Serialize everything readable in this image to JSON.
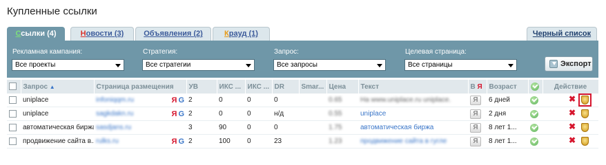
{
  "page": {
    "title": "Купленные ссылки"
  },
  "tabs": [
    {
      "accent": "С",
      "rest": "сылки (4)"
    },
    {
      "accent": "Н",
      "rest": "овости (3)"
    },
    {
      "accent": "О",
      "rest": "бъявления (2)"
    },
    {
      "accent": "К",
      "rest": "рауд (1)"
    }
  ],
  "blacklist": {
    "label": "Черный список"
  },
  "filters": {
    "campaign": {
      "label": "Рекламная кампания:",
      "value": "Все проекты"
    },
    "strategy": {
      "label": "Стратегия:",
      "value": "Все стратегии"
    },
    "query": {
      "label": "Запрос:",
      "value": "Все запросы"
    },
    "target": {
      "label": "Целевая страница:",
      "value": "Все страницы"
    },
    "export_label": "Экспорт"
  },
  "columns": {
    "query": "Запрос",
    "page": "Страница размещения",
    "uv": "УВ",
    "iks1": "ИКС ...",
    "iks2": "ИКС ...",
    "dr": "DR",
    "smart": "Smar...",
    "price": "Цена",
    "text": "Текст",
    "vya": "В",
    "age": "Возраст",
    "action": "Действие"
  },
  "rows": [
    {
      "query": "uniplace",
      "page": "infoniqqm.ru",
      "yandex": "Я",
      "google": "G",
      "uv": "2",
      "iks1": "0",
      "iks2": "0",
      "dr": "0",
      "smart": "",
      "price": "0.65",
      "text": "На www.uniplace.ru uniplace.",
      "age": "6 дней",
      "highlight": true
    },
    {
      "query": "uniplace",
      "page": "sagkdakn.ru",
      "yandex": "Я",
      "google": "G",
      "uv": "2",
      "iks1": "0",
      "iks2": "0",
      "dr": "н/д",
      "smart": "",
      "price": "0.55",
      "text": "uniplace",
      "age": "2 дня",
      "highlight": false
    },
    {
      "query": "автоматическая биржа",
      "page": "sasdjans.ru",
      "yandex": "",
      "google": "",
      "uv": "3",
      "iks1": "90",
      "iks2": "0",
      "dr": "0",
      "smart": "",
      "price": "1.75",
      "text": "автоматическая биржа",
      "age": "8 лет 1...",
      "highlight": false
    },
    {
      "query": "продвижение сайта в...",
      "page": "rulks.ru",
      "yandex": "Я",
      "google": "G",
      "uv": "2",
      "iks1": "100",
      "iks2": "0",
      "dr": "23",
      "smart": "",
      "price": "1.23",
      "text": "продвижение сайта в гугле",
      "age": "8 лет 1...",
      "highlight": false
    }
  ]
}
